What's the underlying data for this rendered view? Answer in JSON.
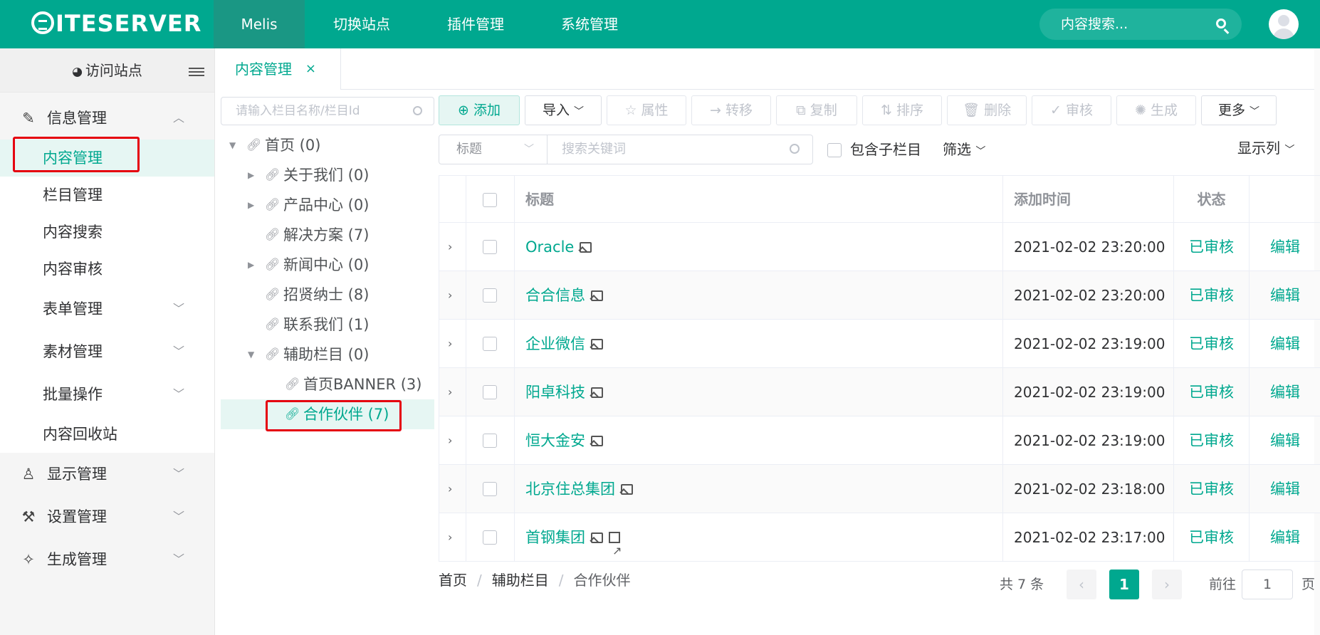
{
  "header": {
    "logo": "ITESERVER",
    "nav": [
      "Melis",
      "切换站点",
      "插件管理",
      "系统管理"
    ],
    "search_placeholder": "内容搜索..."
  },
  "sidebar": {
    "visit_site": "访问站点",
    "groups": [
      {
        "label": "信息管理",
        "icon": "edit-icon",
        "expanded": true
      },
      {
        "label": "显示管理",
        "icon": "tshirt-icon"
      },
      {
        "label": "设置管理",
        "icon": "wrench-icon"
      },
      {
        "label": "生成管理",
        "icon": "magic-wand-icon"
      }
    ],
    "sub_items": [
      "内容管理",
      "栏目管理",
      "内容搜索",
      "内容审核",
      "表单管理",
      "素材管理",
      "批量操作",
      "内容回收站"
    ],
    "active_item": "内容管理"
  },
  "tabs": [
    {
      "label": "内容管理",
      "close": "×"
    }
  ],
  "tree": {
    "search_placeholder": "请输入栏目名称/栏目Id",
    "nodes": [
      {
        "label": "首页 (0)"
      },
      {
        "label": "关于我们 (0)"
      },
      {
        "label": "产品中心 (0)"
      },
      {
        "label": "解决方案 (7)"
      },
      {
        "label": "新闻中心 (0)"
      },
      {
        "label": "招贤纳士 (8)"
      },
      {
        "label": "联系我们 (1)"
      },
      {
        "label": "辅助栏目 (0)"
      },
      {
        "label": "首页BANNER (3)"
      },
      {
        "label": "合作伙伴 (7)"
      }
    ],
    "selected": "合作伙伴 (7)"
  },
  "toolbar": {
    "add": "添加",
    "import": "导入",
    "attr": "属性",
    "move": "转移",
    "copy": "复制",
    "sort": "排序",
    "delete": "删除",
    "audit": "审核",
    "generate": "生成",
    "more": "更多"
  },
  "filter": {
    "field": "标题",
    "keyword_placeholder": "搜索关键词",
    "include_children": "包含子栏目",
    "filter_label": "筛选",
    "columns_label": "显示列"
  },
  "table": {
    "headers": {
      "title": "标题",
      "time": "添加时间",
      "status": "状态"
    },
    "rows": [
      {
        "title": "Oracle",
        "time": "2021-02-02 23:20:00",
        "status": "已审核",
        "action": "编辑"
      },
      {
        "title": "合合信息",
        "time": "2021-02-02 23:20:00",
        "status": "已审核",
        "action": "编辑"
      },
      {
        "title": "企业微信",
        "time": "2021-02-02 23:19:00",
        "status": "已审核",
        "action": "编辑"
      },
      {
        "title": "阳卓科技",
        "time": "2021-02-02 23:19:00",
        "status": "已审核",
        "action": "编辑"
      },
      {
        "title": "恒大金安",
        "time": "2021-02-02 23:19:00",
        "status": "已审核",
        "action": "编辑"
      },
      {
        "title": "北京住总集团",
        "time": "2021-02-02 23:18:00",
        "status": "已审核",
        "action": "编辑"
      },
      {
        "title": "首钢集团",
        "time": "2021-02-02 23:17:00",
        "status": "已审核",
        "action": "编辑"
      }
    ]
  },
  "breadcrumb": [
    "首页",
    "辅助栏目",
    "合作伙伴"
  ],
  "pager": {
    "total": "共 7 条",
    "current": "1",
    "goto": "前往",
    "goto_value": "1",
    "page_unit": "页"
  },
  "colors": {
    "primary": "#00a88f",
    "highlight": "#e5000f"
  }
}
